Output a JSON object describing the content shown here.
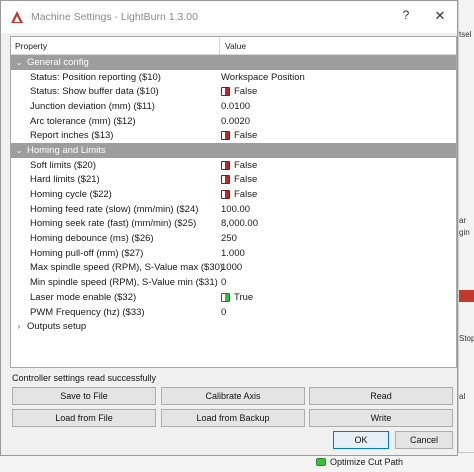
{
  "window": {
    "title": "Machine Settings - LightBurn 1.3.00",
    "help_glyph": "?",
    "close_glyph": "✕"
  },
  "tree": {
    "columns": {
      "property": "Property",
      "value": "Value"
    },
    "rows": [
      {
        "type": "group",
        "expanded": true,
        "label": "General config"
      },
      {
        "type": "item",
        "label": "Status: Position reporting ($10)",
        "value": "Workspace Position",
        "toggle": null
      },
      {
        "type": "item",
        "label": "Status: Show buffer data ($10)",
        "value": "False",
        "toggle": "off"
      },
      {
        "type": "item",
        "label": "Junction deviation (mm) ($11)",
        "value": "0.0100",
        "toggle": null
      },
      {
        "type": "item",
        "label": "Arc tolerance (mm) ($12)",
        "value": "0.0020",
        "toggle": null
      },
      {
        "type": "item",
        "label": "Report inches ($13)",
        "value": "False",
        "toggle": "off"
      },
      {
        "type": "group",
        "expanded": true,
        "label": "Homing and Limits"
      },
      {
        "type": "item",
        "label": "Soft limits ($20)",
        "value": "False",
        "toggle": "off"
      },
      {
        "type": "item",
        "label": "Hard limits ($21)",
        "value": "False",
        "toggle": "off"
      },
      {
        "type": "item",
        "label": "Homing cycle ($22)",
        "value": "False",
        "toggle": "off"
      },
      {
        "type": "item",
        "label": "Homing feed rate (slow) (mm/min) ($24)",
        "value": "100.00",
        "toggle": null
      },
      {
        "type": "item",
        "label": "Homing seek rate (fast) (mm/min) ($25)",
        "value": "8,000.00",
        "toggle": null
      },
      {
        "type": "item",
        "label": "Homing debounce (ms) ($26)",
        "value": "250",
        "toggle": null
      },
      {
        "type": "item",
        "label": "Homing pull-off (mm) ($27)",
        "value": "1.000",
        "toggle": null
      },
      {
        "type": "item",
        "label": "Max spindle speed (RPM), S-Value max ($30)",
        "value": "1000",
        "toggle": null
      },
      {
        "type": "item",
        "label": "Min spindle speed (RPM), S-Value min ($31)",
        "value": "0",
        "toggle": null
      },
      {
        "type": "item",
        "label": "Laser mode enable ($32)",
        "value": "True",
        "toggle": "on"
      },
      {
        "type": "item",
        "label": "PWM Frequency (hz) ($33)",
        "value": "0",
        "toggle": null
      },
      {
        "type": "collapsed",
        "expanded": false,
        "label": "Outputs setup"
      }
    ]
  },
  "status_message": "Controller settings read successfully",
  "buttons": {
    "save_to_file": "Save to File",
    "calibrate_axis": "Calibrate Axis",
    "read": "Read",
    "load_from_file": "Load from File",
    "load_from_backup": "Load from Backup",
    "write": "Write",
    "ok": "OK",
    "cancel": "Cancel"
  },
  "background": {
    "fragments": [
      "tsel",
      "ar",
      "gin",
      "Stop",
      "al"
    ],
    "bottom_option": "Optimize Cut Path"
  },
  "colors": {
    "group_header": "#9d9d9d",
    "toggle_off": "#b52a2a",
    "toggle_on": "#38c038",
    "default_button_border": "#0078d7",
    "logo_red": "#c0392b"
  }
}
